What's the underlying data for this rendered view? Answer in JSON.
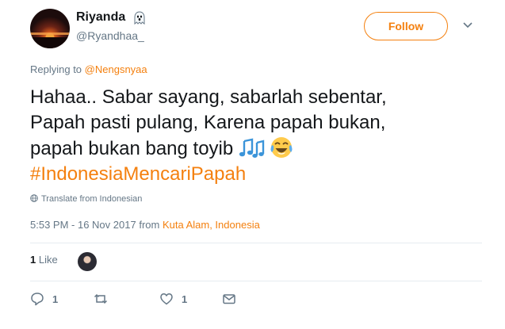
{
  "user": {
    "display_name": "Riyanda",
    "handle": "@Ryandhaa_",
    "name_emoji_icon": "ghost-icon"
  },
  "follow_button": {
    "label": "Follow"
  },
  "reply": {
    "prefix": "Replying to",
    "mention": "@Nengsnyaa"
  },
  "tweet": {
    "line1": "Hahaa.. Sabar sayang, sabarlah sebentar,",
    "line2": "Papah pasti pulang, Karena papah bukan,",
    "line3": "papah bukan bang toyib",
    "hashtag": "#IndonesiaMencariPapah",
    "emojis": [
      "musical-notes-icon",
      "tears-of-joy-icon"
    ]
  },
  "translate": {
    "label": "Translate from Indonesian"
  },
  "meta": {
    "time": "5:53 PM - 16 Nov 2017",
    "from": "from",
    "location": "Kuta Alam, Indonesia"
  },
  "stats": {
    "likes_count": "1",
    "likes_label": "Like"
  },
  "actions": {
    "reply_count": "1",
    "retweet_count": "",
    "like_count": "1"
  },
  "colors": {
    "accent": "#f4800f",
    "muted": "#657786",
    "text": "#14171a",
    "divider": "#e6ecf0"
  }
}
